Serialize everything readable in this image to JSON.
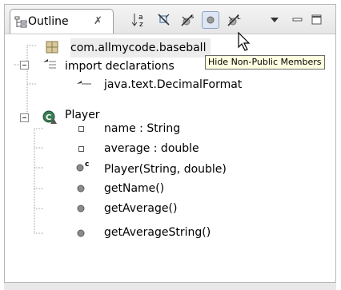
{
  "view": {
    "tab_label": "Outline",
    "tab_close": "✗",
    "tab_icon": "outline-view-icon"
  },
  "toolbar": {
    "buttons": [
      {
        "name": "sort-button",
        "icon": "sort-az-icon"
      },
      {
        "name": "hide-fields-button",
        "icon": "hide-fields-icon"
      },
      {
        "name": "hide-static-button",
        "icon": "hide-static-icon"
      },
      {
        "name": "hide-non-public-button",
        "icon": "hide-non-public-icon",
        "pressed": true
      },
      {
        "name": "hide-local-types-button",
        "icon": "hide-local-types-icon"
      },
      {
        "name": "view-menu-button",
        "icon": "dropdown-arrow-icon"
      },
      {
        "name": "minimize-button",
        "icon": "minimize-icon"
      },
      {
        "name": "maximize-button",
        "icon": "maximize-icon"
      }
    ],
    "sort_glyph_top": "a",
    "sort_glyph_bottom": "z",
    "static_glyph": "s",
    "local_glyph": "L"
  },
  "tree": {
    "package": "com.allmycode.baseball",
    "imports_label": "import declarations",
    "import_item": "java.text.DecimalFormat",
    "class_name": "Player",
    "members": [
      {
        "label": "name : String",
        "kind": "field"
      },
      {
        "label": "average : double",
        "kind": "field"
      },
      {
        "label": "Player(String, double)",
        "kind": "constructor",
        "badge": "c"
      },
      {
        "label": "getName()",
        "kind": "method"
      },
      {
        "label": "getAverage()",
        "kind": "method"
      },
      {
        "label": "getAverageString()",
        "kind": "method"
      }
    ]
  },
  "tooltip": "Hide Non-Public Members",
  "colors": {
    "method_green": "#4caf50",
    "field_blue": "#6b8dbb",
    "class_green": "#2e8b57"
  }
}
